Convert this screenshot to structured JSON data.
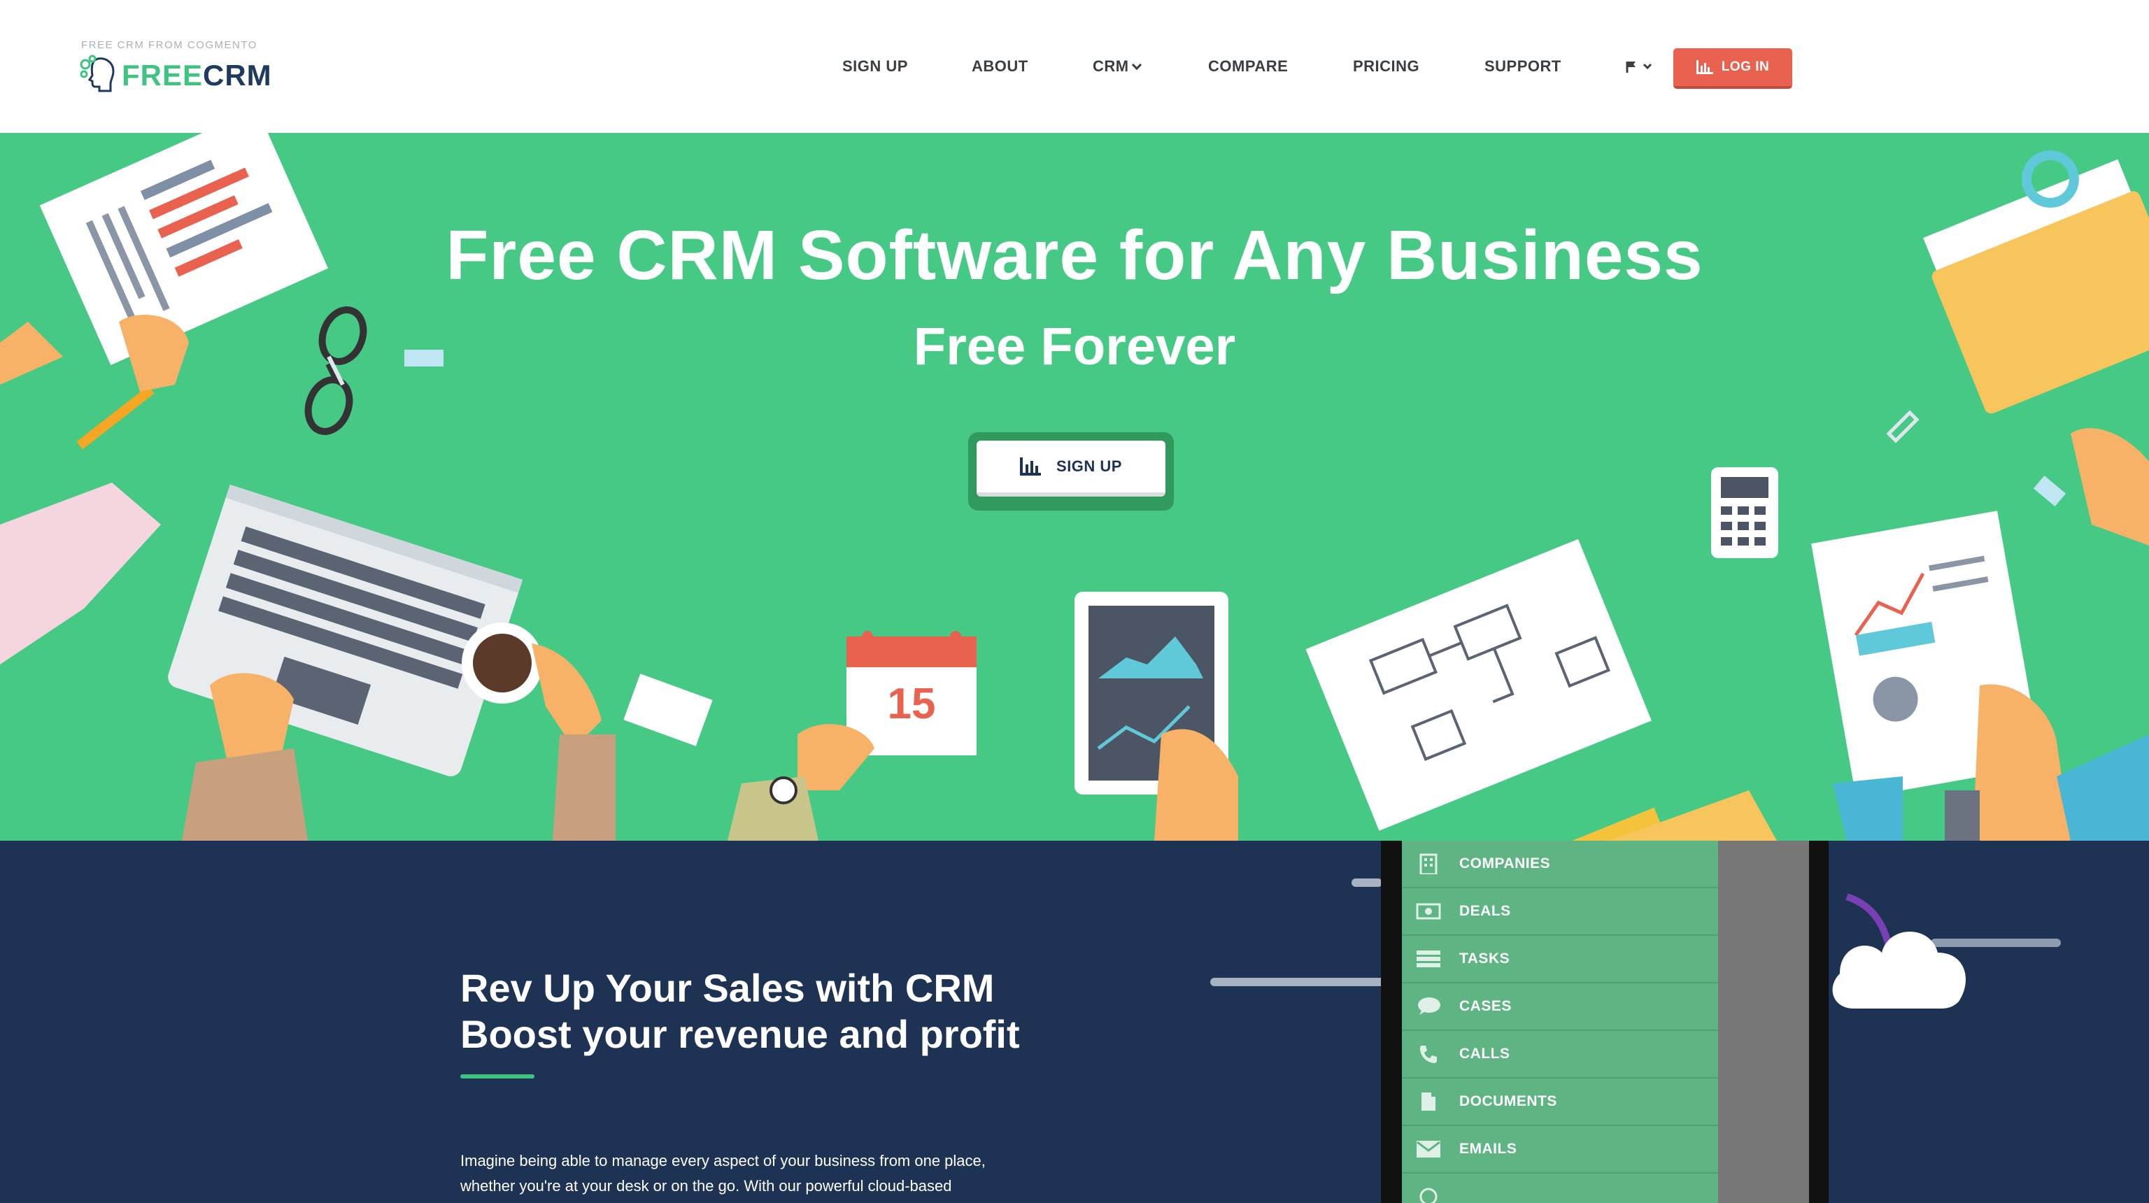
{
  "header": {
    "logo_tagline": "FREE CRM FROM COGMENTO",
    "logo_free": "FREE",
    "logo_crm": "CRM",
    "nav": {
      "sign_up": "SIGN UP",
      "about": "ABOUT",
      "crm": "CRM",
      "compare": "COMPARE",
      "pricing": "PRICING",
      "support": "SUPPORT"
    },
    "flag_icon": "flag-icon",
    "login_label": "LOG IN"
  },
  "hero": {
    "title": "Free CRM Software for Any Business",
    "subtitle": "Free Forever",
    "signup_label": "SIGN UP",
    "calendar_day": "15"
  },
  "feature": {
    "heading_line1": "Rev Up Your Sales with CRM",
    "heading_line2": "Boost your revenue and profit",
    "body_line1": "Imagine being able to manage every aspect of your business from one place,",
    "body_line2": "whether you're at your desk or on the go. With our powerful cloud-based",
    "menu": [
      {
        "label": "COMPANIES",
        "icon": "building-icon"
      },
      {
        "label": "DEALS",
        "icon": "money-icon"
      },
      {
        "label": "TASKS",
        "icon": "tasks-icon"
      },
      {
        "label": "CASES",
        "icon": "chat-bubble-icon"
      },
      {
        "label": "CALLS",
        "icon": "phone-icon"
      },
      {
        "label": "DOCUMENTS",
        "icon": "document-icon"
      },
      {
        "label": "EMAILS",
        "icon": "envelope-icon"
      }
    ]
  },
  "colors": {
    "brand_green": "#46c985",
    "navy": "#1e3354",
    "login_red": "#e8624f"
  }
}
